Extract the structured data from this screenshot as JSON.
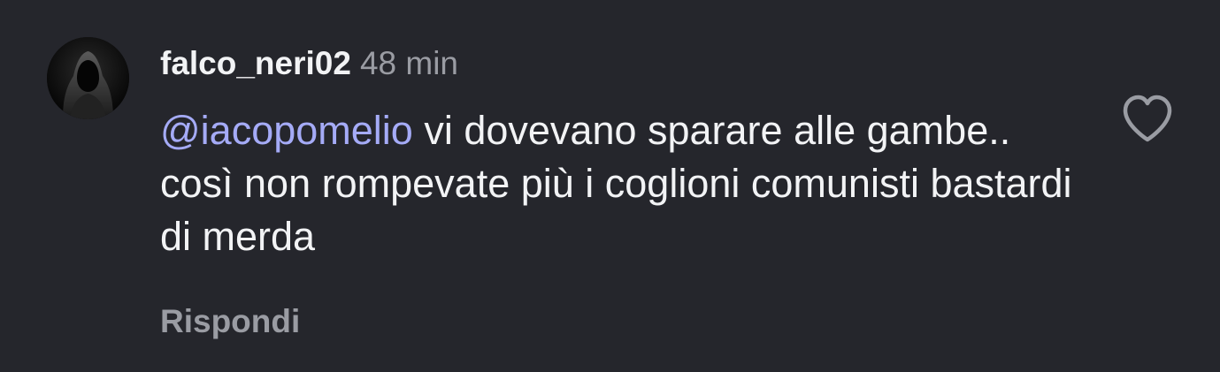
{
  "comment": {
    "username": "falco_neri02",
    "timestamp": "48 min",
    "mention": "@iacopomelio",
    "text": " vi dovevano sparare alle gambe.. così non rompevate più i coglioni comunisti bastardi di merda",
    "reply_label": "Rispondi",
    "avatar_icon": "hooded-figure-avatar",
    "like_icon": "heart-outline-icon"
  },
  "colors": {
    "background": "#25262c",
    "text": "#f2f3f5",
    "secondary": "#9a9ca3",
    "mention": "#a5abf7"
  }
}
